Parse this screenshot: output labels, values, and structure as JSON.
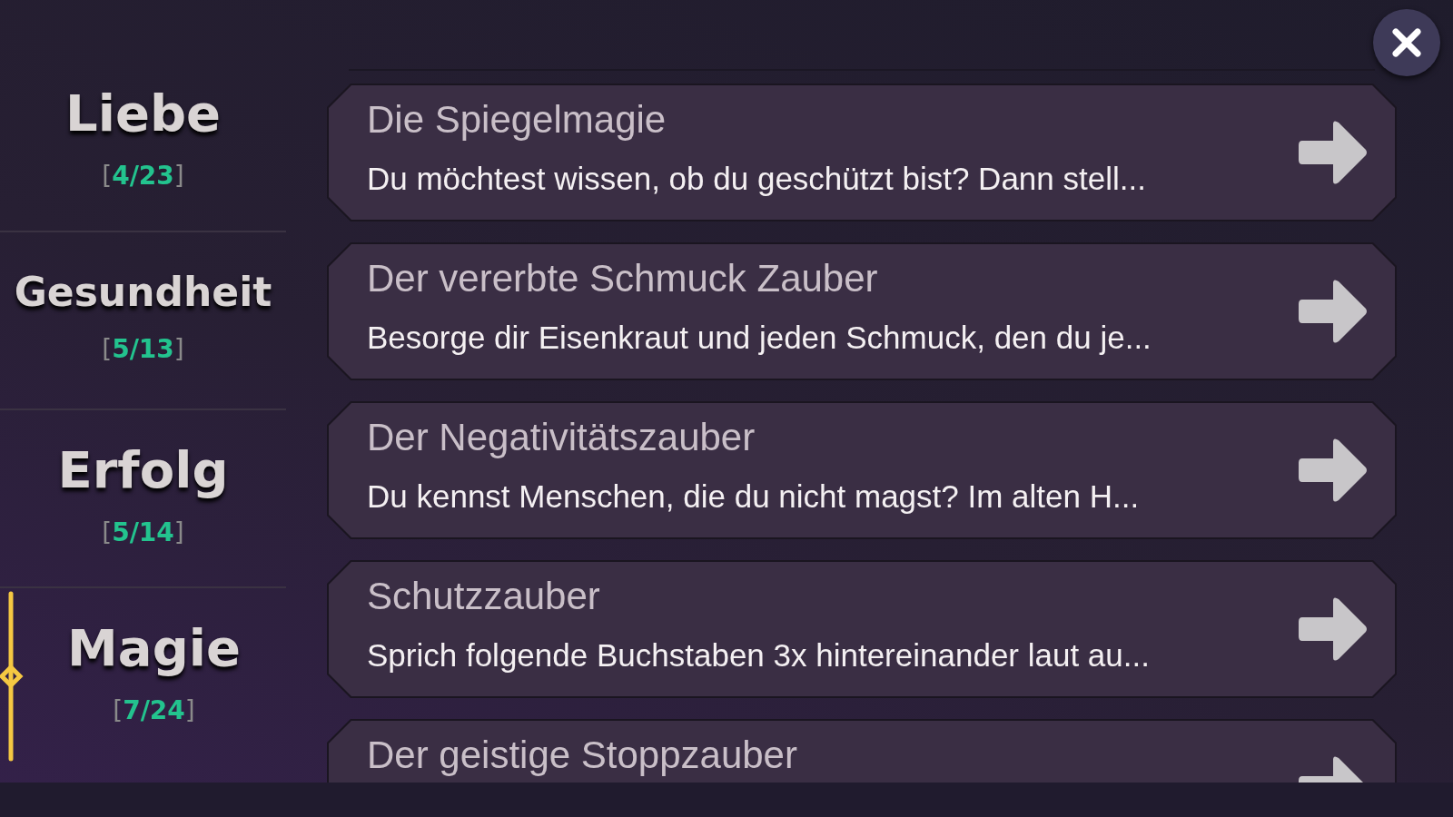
{
  "categories": [
    {
      "label": "Liebe",
      "count": "[4/23]",
      "selected": false
    },
    {
      "label": "Gesundheit",
      "count": "[5/13]",
      "selected": false
    },
    {
      "label": "Erfolg",
      "count": "[5/14]",
      "selected": false
    },
    {
      "label": "Magie",
      "count": "[7/24]",
      "selected": true
    }
  ],
  "spells": [
    {
      "title": "Die Spiegelmagie",
      "description": "Du möchtest wissen, ob du geschützt bist? Dann stell..."
    },
    {
      "title": "Der vererbte Schmuck Zauber",
      "description": "Besorge dir Eisenkraut und jeden Schmuck, den du je..."
    },
    {
      "title": "Der Negativitätszauber",
      "description": "Du kennst Menschen, die du nicht magst? Im alten H..."
    },
    {
      "title": "Schutzzauber",
      "description": "Sprich folgende Buchstaben 3x hintereinander laut au..."
    },
    {
      "title": "Der geistige Stoppzauber"
    }
  ]
}
